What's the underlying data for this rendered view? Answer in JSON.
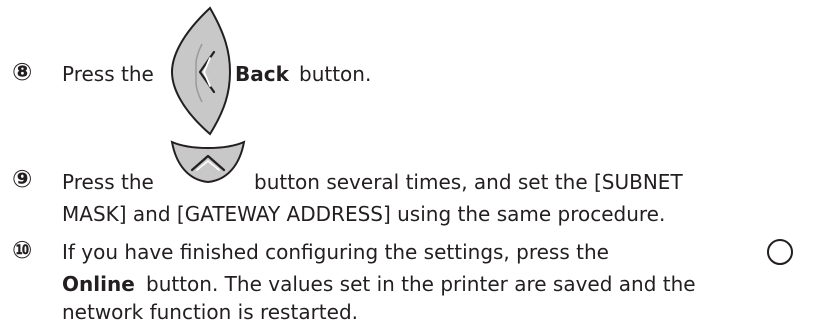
{
  "steps": [
    {
      "number": "⑧",
      "text_before_icon": "Press the",
      "icon": "back-button-icon",
      "bold_label": "Back",
      "text_after": "button."
    },
    {
      "number": "⑨",
      "text_before_icon": "Press the",
      "icon": "up-arrow-button-icon",
      "text_after": "button several times, and set the [SUBNET",
      "line2": "MASK] and [GATEWAY ADDRESS] using the same procedure."
    },
    {
      "number": "⑩",
      "line1": "If you have finished configuring the settings, press the",
      "icon": "online-button-icon",
      "bold_label": "Online",
      "line2_rest": "button. The values set in the printer are saved and the",
      "line3": "network function is restarted."
    }
  ]
}
